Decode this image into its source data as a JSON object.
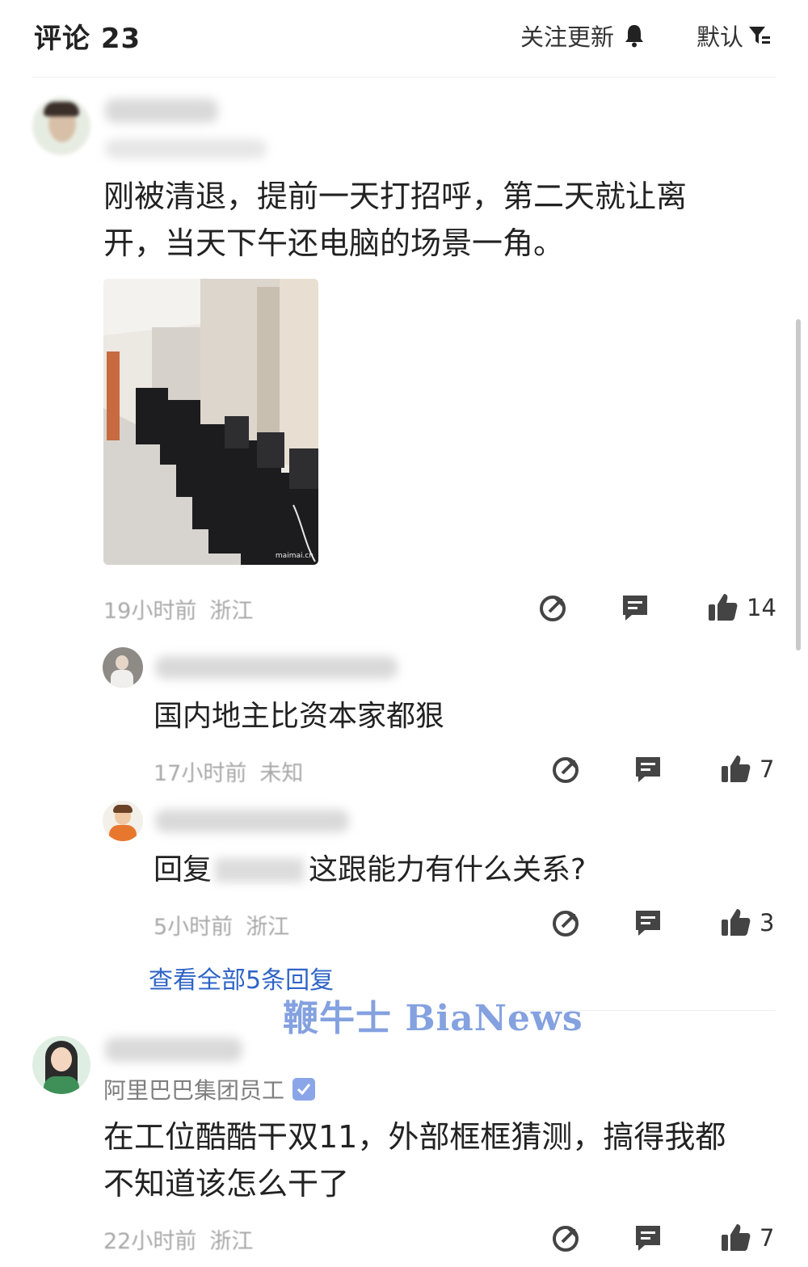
{
  "header": {
    "title": "评论 23",
    "follow_label": "关注更新",
    "sort_label": "默认"
  },
  "comments": [
    {
      "text_line1": "刚被清退，提前一天打招呼，第二天就让离",
      "text_line2": "开，当天下午还电脑的场景一角。",
      "time": "19小时前",
      "location": "浙江",
      "likes": "14",
      "image_watermark": "maimai.cn"
    },
    {
      "text": "国内地主比资本家都狠",
      "time": "17小时前",
      "location": "未知",
      "likes": "7"
    },
    {
      "text_prefix": "回复",
      "text_main": "这跟能力有什么关系?",
      "time": "5小时前",
      "location": "浙江",
      "likes": "3"
    },
    {
      "role": "阿里巴巴集团员工",
      "text_line1": "在工位酷酷干双11，外部框框猜测，搞得我都",
      "text_line2": "不知道该怎么干了",
      "time": "22小时前",
      "location": "浙江",
      "likes": "7"
    }
  ],
  "view_all_replies": "查看全部5条回复",
  "watermark": "鞭牛士 BiaNews",
  "icons": {
    "bell": "bell-icon",
    "filter": "filter-icon",
    "share": "share-icon",
    "reply": "comment-icon",
    "like": "thumbs-up-icon"
  }
}
